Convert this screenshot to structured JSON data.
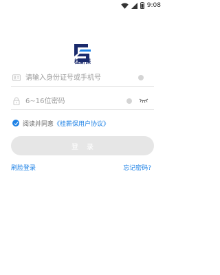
{
  "status_bar": {
    "time": "9:08",
    "icons": [
      "wifi-icon",
      "signal-icon",
      "battery-icon"
    ]
  },
  "app": {
    "name": "桂薪保",
    "logo_icon": "gx-logo-icon"
  },
  "login_form": {
    "id_placeholder": "请输入身份证号或手机号",
    "password_placeholder": "6~16位密码",
    "id_value": "",
    "password_value": ""
  },
  "agreement": {
    "checked": true,
    "prefix": "阅读并同意",
    "link": "《桂薪保用户协议》"
  },
  "login_button_label": "登录",
  "links": {
    "face_login": "刷脸登录",
    "forgot_password": "忘记密码?"
  },
  "colors": {
    "accent": "#1e82e6",
    "logo_navy": "#1a2a6c",
    "button_disabled": "#e6e6e6"
  }
}
